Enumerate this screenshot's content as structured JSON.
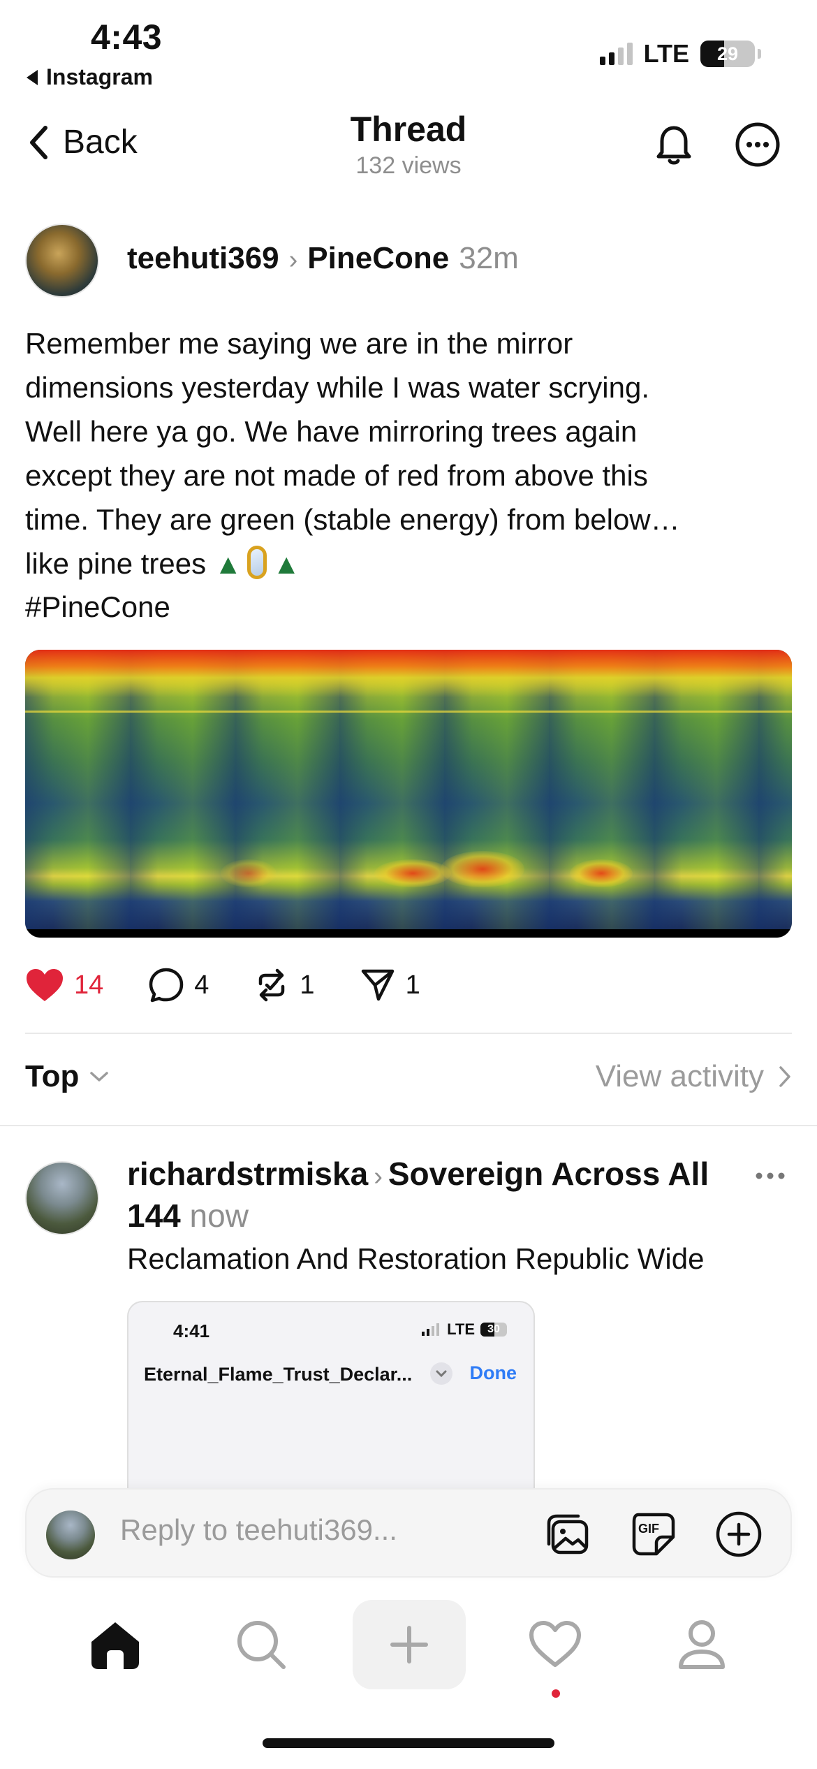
{
  "status_bar": {
    "time": "4:43",
    "back_app": "Instagram",
    "network": "LTE",
    "battery": "29"
  },
  "header": {
    "back_label": "Back",
    "title": "Thread",
    "views": "132 views"
  },
  "post": {
    "username": "teehuti369",
    "topic": "PineCone",
    "time": "32m",
    "lines": [
      "Remember me saying we are in the mirror",
      "dimensions yesterday while I was water scrying.",
      "Well here ya go. We have mirroring trees again",
      "except they are not made of red from above this",
      "time. They are green (stable energy) from below…"
    ],
    "last_line_text": "like pine trees",
    "emoji": [
      "evergreen-tree",
      "mirror",
      "evergreen-tree"
    ],
    "hashtag": "#PineCone",
    "likes": "14",
    "replies": "4",
    "reposts": "1",
    "shares": "1",
    "liked": true,
    "accent_like": "#e0243a"
  },
  "sort": {
    "label": "Top",
    "view_activity": "View activity"
  },
  "reply": {
    "username": "richardstrmiska",
    "topic": "Sovereign Across All 144",
    "time": "now",
    "text": "Reclamation And Restoration Republic Wide",
    "screenshot": {
      "time": "4:41",
      "network": "LTE",
      "battery": "30",
      "file_name": "Eternal_Flame_Trust_Declar...",
      "done_label": "Done"
    }
  },
  "composer": {
    "placeholder": "Reply to teehuti369..."
  },
  "tabbar": {
    "items": [
      "home-icon",
      "search-icon",
      "create-icon",
      "heart-icon",
      "profile-icon"
    ],
    "active": "home-icon"
  }
}
